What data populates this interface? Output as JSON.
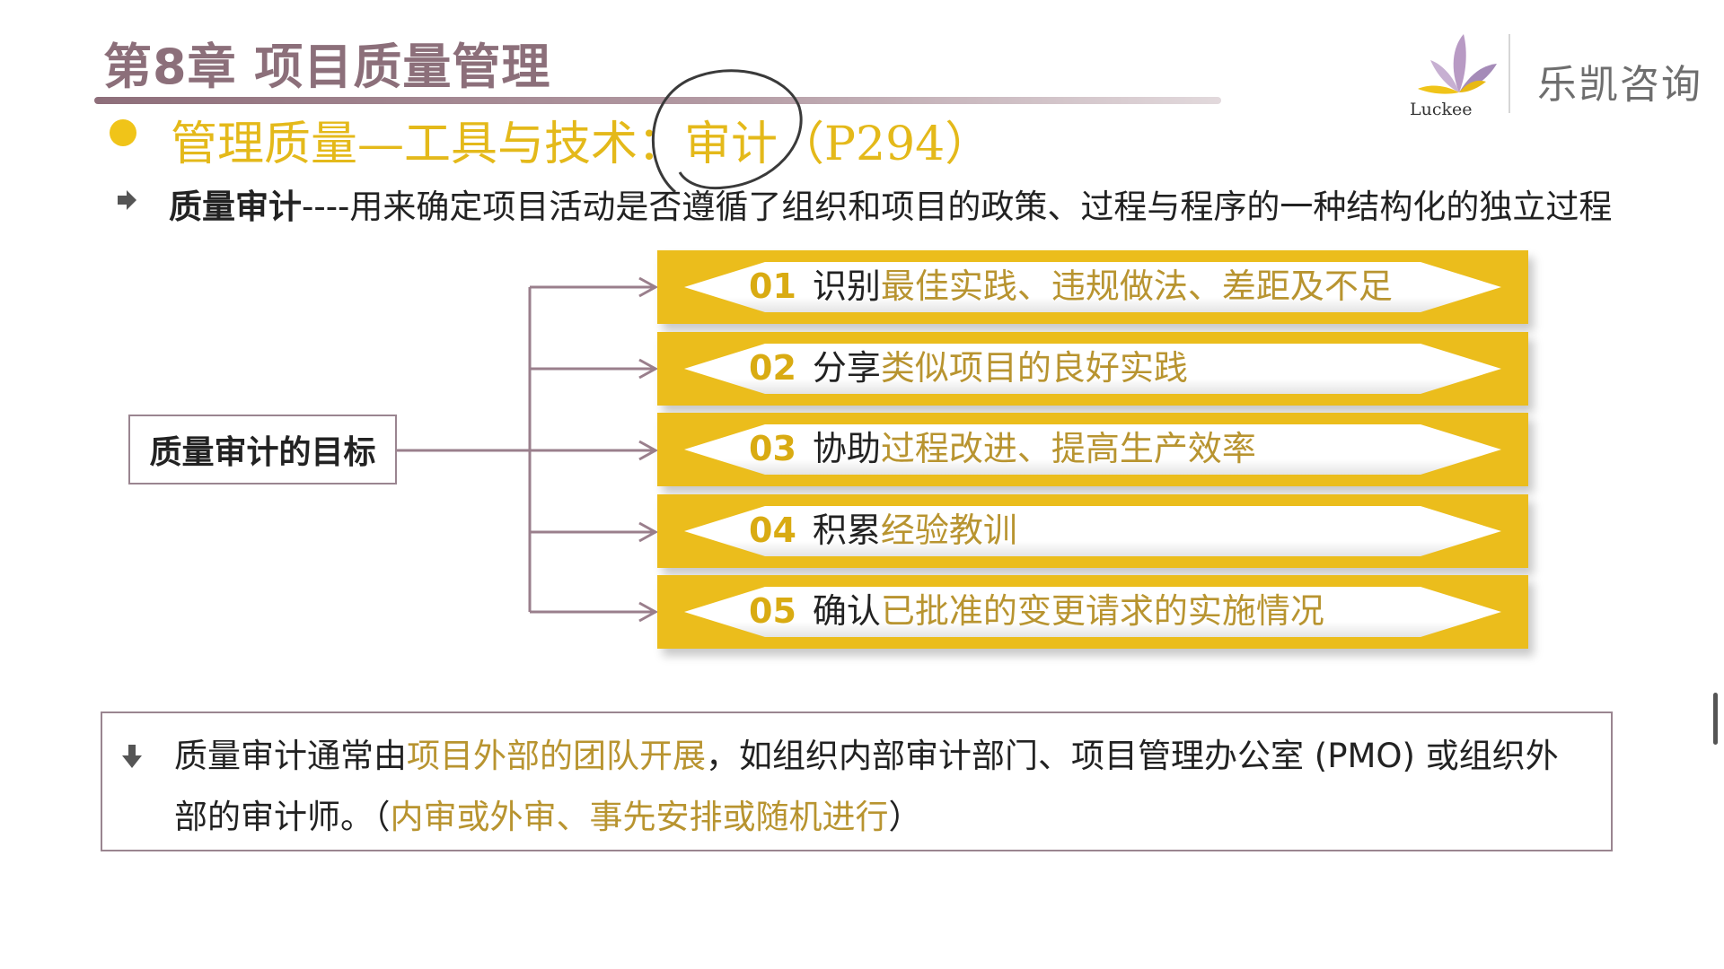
{
  "header": {
    "chapter_title": "第8章 项目质量管理"
  },
  "logo": {
    "mark_text": "Luckee",
    "brand_name": "乐凯咨询"
  },
  "subtitle": "管理质量—工具与技术：审计（P294）",
  "definition": {
    "term": "质量审计",
    "separator": "----",
    "text": "用来确定项目活动是否遵循了组织和项目的政策、过程与程序的一种结构化的独立过程"
  },
  "goal_box_label": "质量审计的目标",
  "goals": [
    {
      "num": "01",
      "prefix": "识别",
      "highlight": "最佳实践、违规做法、差距及不足"
    },
    {
      "num": "02",
      "prefix": "分享",
      "highlight": "类似项目的良好实践"
    },
    {
      "num": "03",
      "prefix": "协助",
      "highlight": "过程改进、提高生产效率"
    },
    {
      "num": "04",
      "prefix": "积累",
      "highlight": "经验教训"
    },
    {
      "num": "05",
      "prefix": "确认",
      "highlight": "已批准的变更请求的实施情况"
    }
  ],
  "note": {
    "part1": "质量审计通常由",
    "highlight1": "项目外部的团队开展",
    "part2": "，如组织内部审计部门、项目管理办公室 (PMO) 或组织外部的审计师。（",
    "highlight2": "内审或外审、事先安排或随机进行",
    "part3": "）"
  },
  "colors": {
    "accent_yellow": "#ebbd1c",
    "highlight_text": "#b89430",
    "title_mauve": "#8c6f7a"
  }
}
